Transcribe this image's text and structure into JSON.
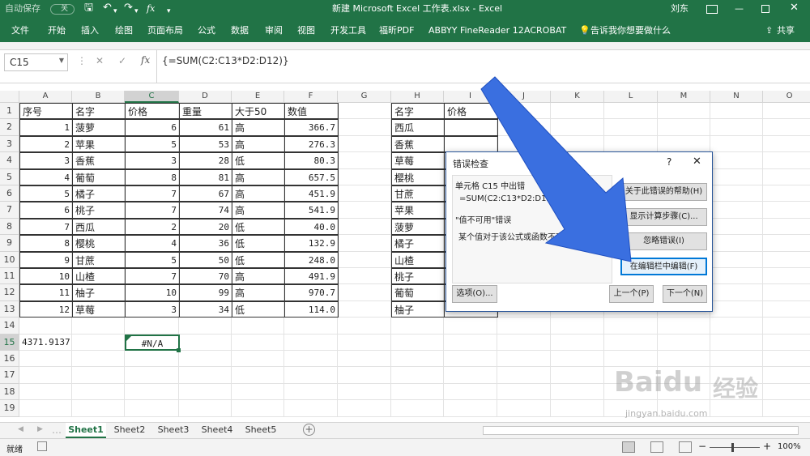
{
  "titlebar": {
    "autosave": "自动保存",
    "autosave_state": "关",
    "title": "新建 Microsoft Excel 工作表.xlsx  -  Excel",
    "user": "刘东"
  },
  "ribbon": {
    "tabs": [
      "文件",
      "开始",
      "插入",
      "绘图",
      "页面布局",
      "公式",
      "数据",
      "审阅",
      "视图",
      "开发工具",
      "福昕PDF",
      "ABBYY FineReader 12",
      "ACROBAT"
    ],
    "tell_me": "告诉我你想要做什么",
    "share": "共享"
  },
  "formula_bar": {
    "name_box": "C15",
    "formula": "{=SUM(C2:C13*D2:D12)}"
  },
  "columns": [
    "A",
    "B",
    "C",
    "D",
    "E",
    "F",
    "G",
    "H",
    "I",
    "J",
    "K",
    "L",
    "M",
    "N",
    "O"
  ],
  "rows": [
    "1",
    "2",
    "3",
    "4",
    "5",
    "6",
    "7",
    "8",
    "9",
    "10",
    "11",
    "12",
    "13",
    "14",
    "15",
    "16",
    "17",
    "18",
    "19"
  ],
  "table1": {
    "headers": [
      "序号",
      "名字",
      "价格",
      "重量",
      "大于50",
      "数值"
    ],
    "rows": [
      [
        "1",
        "菠萝",
        "6",
        "61",
        "高",
        "366.7"
      ],
      [
        "2",
        "苹果",
        "5",
        "53",
        "高",
        "276.3"
      ],
      [
        "3",
        "香蕉",
        "3",
        "28",
        "低",
        "80.3"
      ],
      [
        "4",
        "葡萄",
        "8",
        "81",
        "高",
        "657.5"
      ],
      [
        "5",
        "橘子",
        "7",
        "67",
        "高",
        "451.9"
      ],
      [
        "6",
        "桃子",
        "7",
        "74",
        "高",
        "541.9"
      ],
      [
        "7",
        "西瓜",
        "2",
        "20",
        "低",
        "40.0"
      ],
      [
        "8",
        "樱桃",
        "4",
        "36",
        "低",
        "132.9"
      ],
      [
        "9",
        "甘蔗",
        "5",
        "50",
        "低",
        "248.0"
      ],
      [
        "10",
        "山楂",
        "7",
        "70",
        "高",
        "491.9"
      ],
      [
        "11",
        "柚子",
        "10",
        "99",
        "高",
        "970.7"
      ],
      [
        "12",
        "草莓",
        "3",
        "34",
        "低",
        "114.0"
      ]
    ]
  },
  "table2": {
    "headers": [
      "名字",
      "价格"
    ],
    "names": [
      "西瓜",
      "香蕉",
      "草莓",
      "樱桃",
      "甘蔗",
      "苹果",
      "菠萝",
      "橘子",
      "山楂",
      "桃子",
      "葡萄",
      "柚子"
    ]
  },
  "row15": {
    "a": "4371.9137",
    "c": "#N/A"
  },
  "dialog": {
    "title": "错误检查",
    "help_glyph": "?",
    "close_glyph": "✕",
    "cell_label": "单元格 C15 中出错",
    "formula": "=SUM(C2:C13*D2:D12)",
    "error_name": "\"值不可用\"错误",
    "error_desc": "某个值对于该公式或函数不可用。",
    "btn_help": "关于此错误的帮助(H)",
    "btn_steps": "显示计算步骤(C)...",
    "btn_ignore": "忽略错误(I)",
    "btn_edit": "在编辑栏中编辑(F)",
    "btn_options": "选项(O)...",
    "btn_prev": "上一个(P)",
    "btn_next": "下一个(N)"
  },
  "sheets": [
    "Sheet1",
    "Sheet2",
    "Sheet3",
    "Sheet4",
    "Sheet5"
  ],
  "status": {
    "ready": "就绪",
    "zoom": "100%"
  },
  "watermark": {
    "brand": "Baidu",
    "cn": "经验",
    "url": "jingyan.baidu.com"
  },
  "colors": {
    "excel_green": "#217346",
    "dialog_border": "#2b579a",
    "arrow_blue": "#3a6fe0"
  }
}
